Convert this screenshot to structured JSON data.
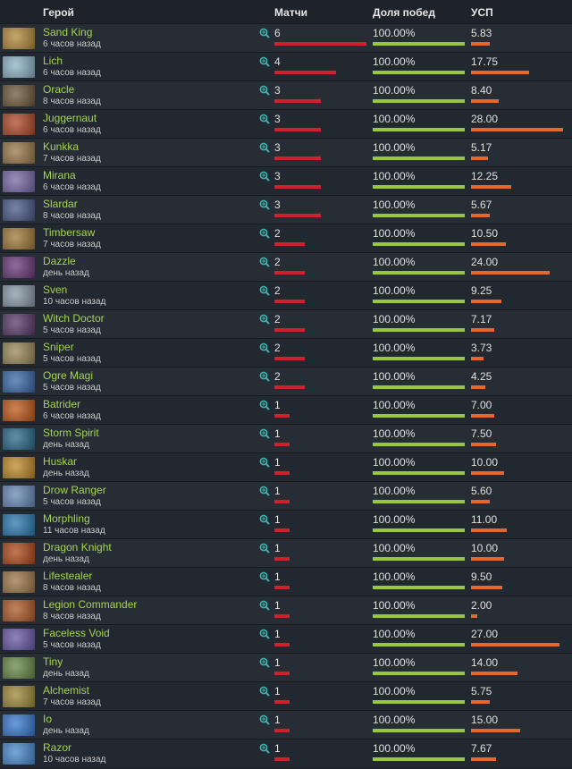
{
  "header": {
    "hero": "Герой",
    "matches": "Матчи",
    "winrate": "Доля побед",
    "kda": "УСП"
  },
  "rows": [
    {
      "hero": "Sand King",
      "time": "6 часов назад",
      "matches": "6",
      "winrate": "100.00%",
      "kda": "5.83",
      "color": "#b48a3a"
    },
    {
      "hero": "Lich",
      "time": "6 часов назад",
      "matches": "4",
      "winrate": "100.00%",
      "kda": "17.75",
      "color": "#8fb4c8"
    },
    {
      "hero": "Oracle",
      "time": "8 часов назад",
      "matches": "3",
      "winrate": "100.00%",
      "kda": "8.40",
      "color": "#6f5a3c"
    },
    {
      "hero": "Juggernaut",
      "time": "6 часов назад",
      "matches": "3",
      "winrate": "100.00%",
      "kda": "28.00",
      "color": "#b04a2a"
    },
    {
      "hero": "Kunkka",
      "time": "7 часов назад",
      "matches": "3",
      "winrate": "100.00%",
      "kda": "5.17",
      "color": "#9a7a4a"
    },
    {
      "hero": "Mirana",
      "time": "6 часов назад",
      "matches": "3",
      "winrate": "100.00%",
      "kda": "12.25",
      "color": "#7a6aa8"
    },
    {
      "hero": "Slardar",
      "time": "8 часов назад",
      "matches": "3",
      "winrate": "100.00%",
      "kda": "5.67",
      "color": "#4a5a8a"
    },
    {
      "hero": "Timbersaw",
      "time": "7 часов назад",
      "matches": "2",
      "winrate": "100.00%",
      "kda": "10.50",
      "color": "#a07a3a"
    },
    {
      "hero": "Dazzle",
      "time": "день назад",
      "matches": "2",
      "winrate": "100.00%",
      "kda": "24.00",
      "color": "#6a3a7a"
    },
    {
      "hero": "Sven",
      "time": "10 часов назад",
      "matches": "2",
      "winrate": "100.00%",
      "kda": "9.25",
      "color": "#8a9aa8"
    },
    {
      "hero": "Witch Doctor",
      "time": "5 часов назад",
      "matches": "2",
      "winrate": "100.00%",
      "kda": "7.17",
      "color": "#5a3a6a"
    },
    {
      "hero": "Sniper",
      "time": "5 часов назад",
      "matches": "2",
      "winrate": "100.00%",
      "kda": "3.73",
      "color": "#9a8a5a"
    },
    {
      "hero": "Ogre Magi",
      "time": "5 часов назад",
      "matches": "2",
      "winrate": "100.00%",
      "kda": "4.25",
      "color": "#3a6aa8"
    },
    {
      "hero": "Batrider",
      "time": "6 часов назад",
      "matches": "1",
      "winrate": "100.00%",
      "kda": "7.00",
      "color": "#c05a1a"
    },
    {
      "hero": "Storm Spirit",
      "time": "день назад",
      "matches": "1",
      "winrate": "100.00%",
      "kda": "7.50",
      "color": "#2a6a8a"
    },
    {
      "hero": "Huskar",
      "time": "день назад",
      "matches": "1",
      "winrate": "100.00%",
      "kda": "10.00",
      "color": "#c08a2a"
    },
    {
      "hero": "Drow Ranger",
      "time": "5 часов назад",
      "matches": "1",
      "winrate": "100.00%",
      "kda": "5.60",
      "color": "#6a8ab8"
    },
    {
      "hero": "Morphling",
      "time": "11 часов назад",
      "matches": "1",
      "winrate": "100.00%",
      "kda": "11.00",
      "color": "#2a7ab0"
    },
    {
      "hero": "Dragon Knight",
      "time": "день назад",
      "matches": "1",
      "winrate": "100.00%",
      "kda": "10.00",
      "color": "#b04a1a"
    },
    {
      "hero": "Lifestealer",
      "time": "8 часов назад",
      "matches": "1",
      "winrate": "100.00%",
      "kda": "9.50",
      "color": "#a07a4a"
    },
    {
      "hero": "Legion Commander",
      "time": "8 часов назад",
      "matches": "1",
      "winrate": "100.00%",
      "kda": "2.00",
      "color": "#b05a2a"
    },
    {
      "hero": "Faceless Void",
      "time": "5 часов назад",
      "matches": "1",
      "winrate": "100.00%",
      "kda": "27.00",
      "color": "#6a5aa8"
    },
    {
      "hero": "Tiny",
      "time": "день назад",
      "matches": "1",
      "winrate": "100.00%",
      "kda": "14.00",
      "color": "#6a8a4a"
    },
    {
      "hero": "Alchemist",
      "time": "7 часов назад",
      "matches": "1",
      "winrate": "100.00%",
      "kda": "5.75",
      "color": "#a08a3a"
    },
    {
      "hero": "Io",
      "time": "день назад",
      "matches": "1",
      "winrate": "100.00%",
      "kda": "15.00",
      "color": "#3a7ad0"
    },
    {
      "hero": "Razor",
      "time": "10 часов назад",
      "matches": "1",
      "winrate": "100.00%",
      "kda": "7.67",
      "color": "#4a8ad0"
    }
  ],
  "colors": {
    "matches_bar": "#d0202c",
    "winrate_bar": "#98c543",
    "kda_bar": "#e4672b",
    "hero_name": "#a7d452"
  },
  "icons": {
    "match_details": "magnifier-plus-icon"
  }
}
